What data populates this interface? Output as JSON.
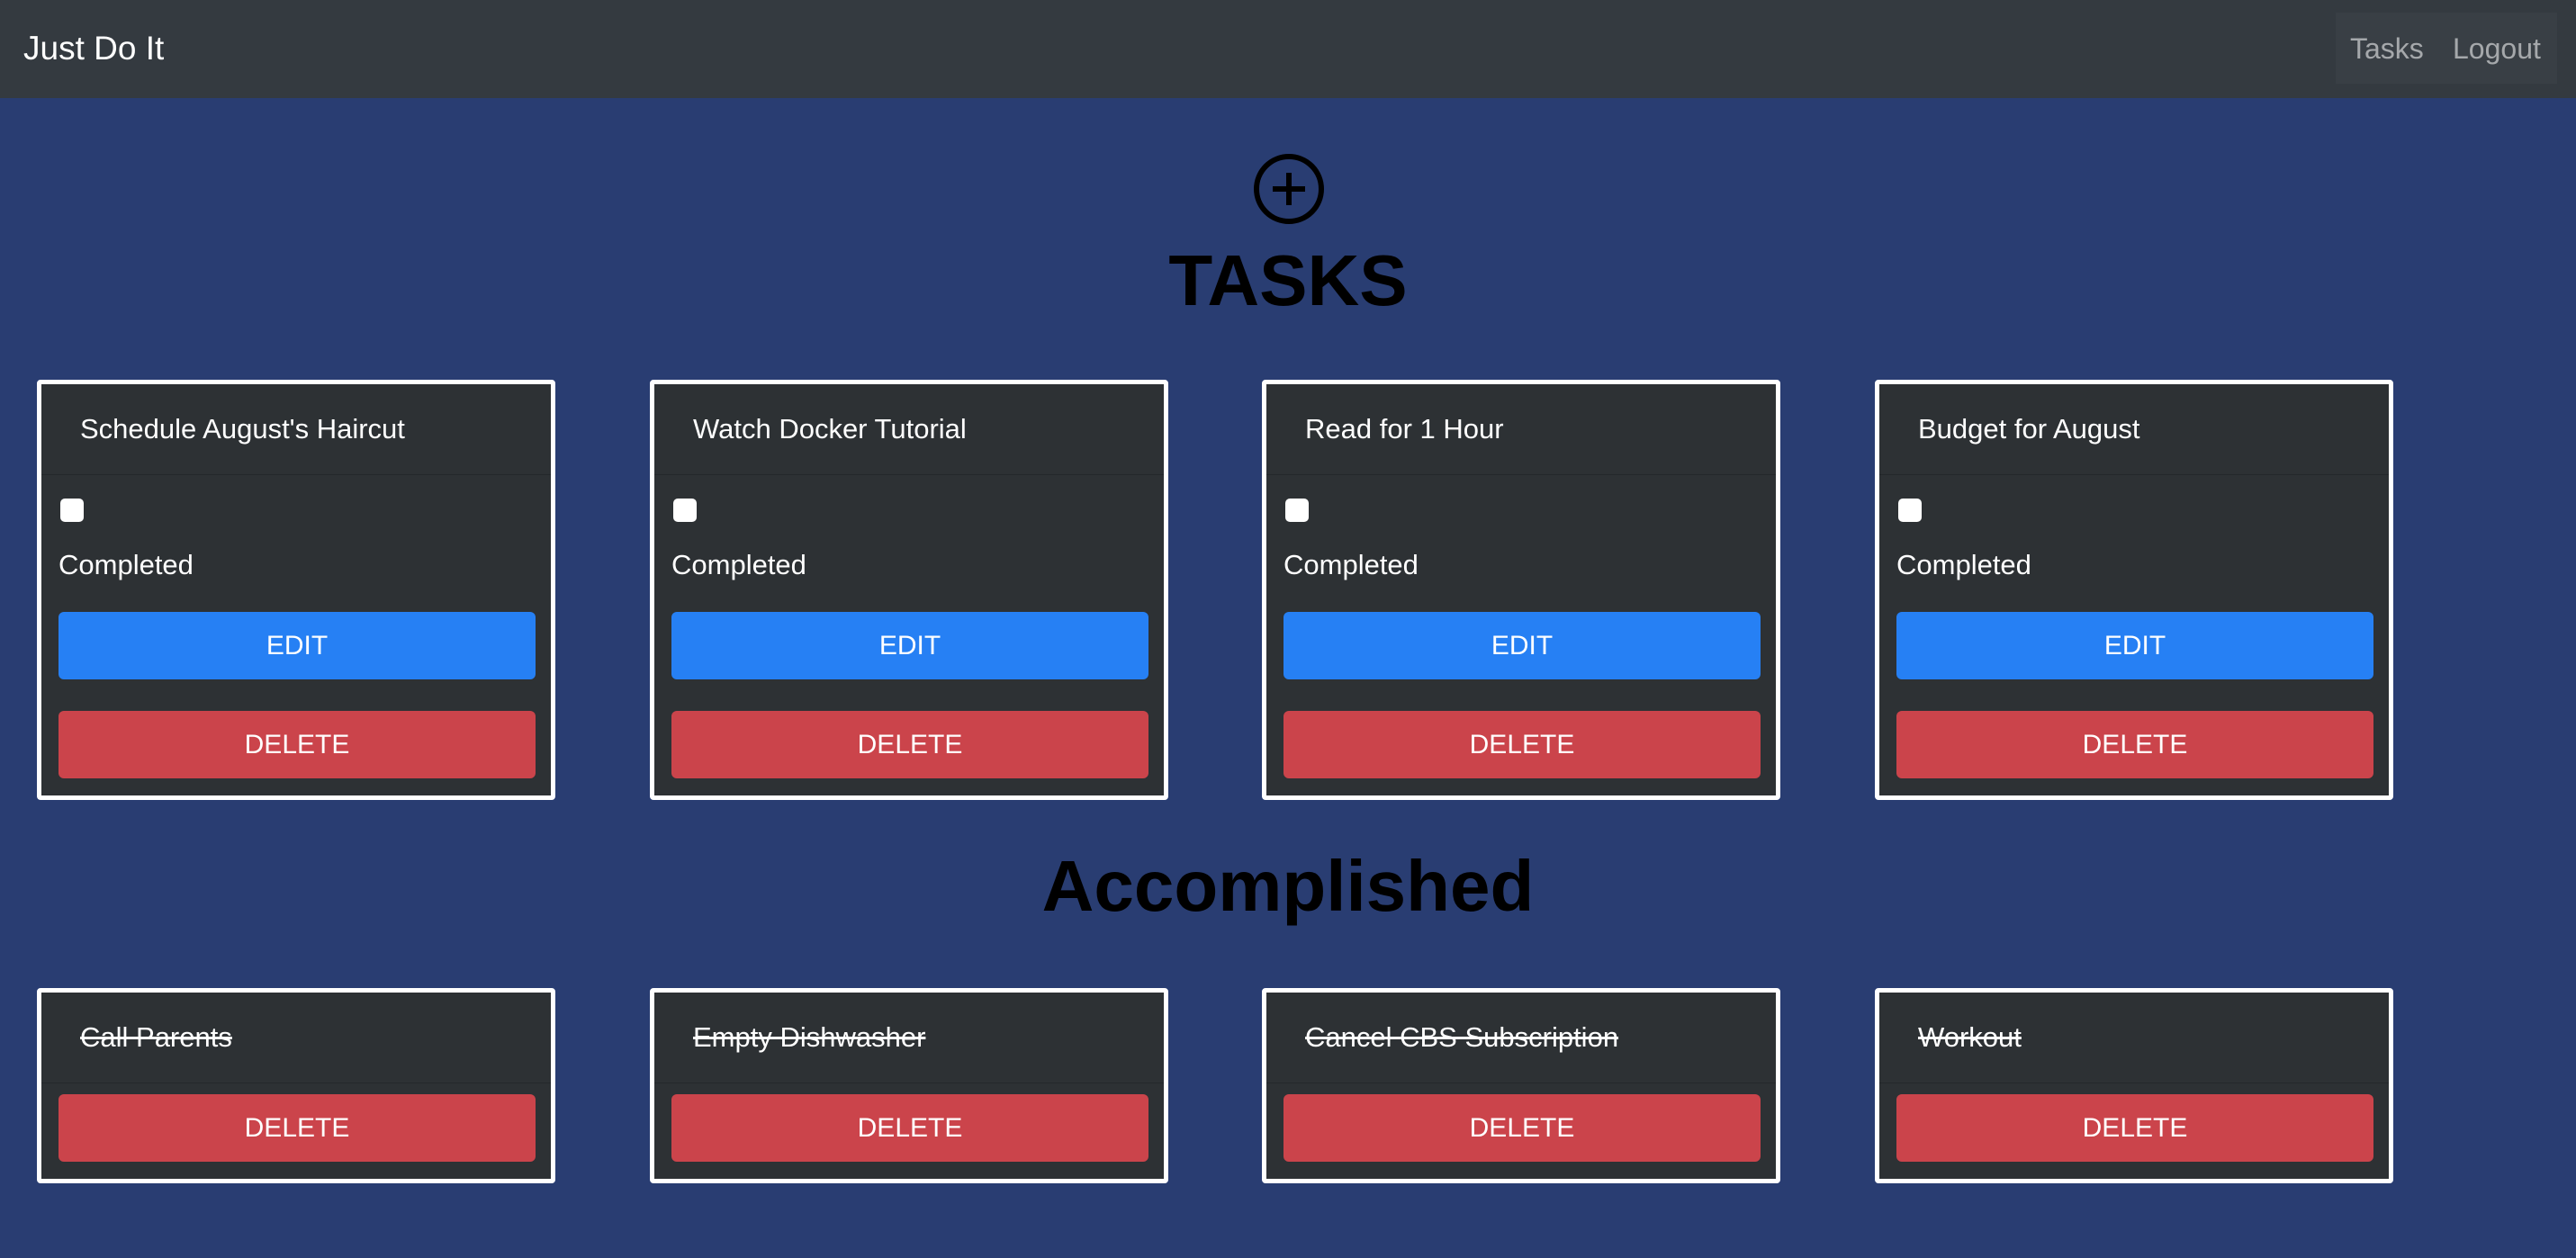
{
  "navbar": {
    "brand": "Just Do It",
    "links": [
      {
        "label": "Tasks"
      },
      {
        "label": "Logout"
      }
    ]
  },
  "header": {
    "add_icon": "plus-circle-icon",
    "tasks_title": "TASKS",
    "accomplished_title": "Accomplished"
  },
  "tasks": [
    {
      "title": "Schedule August's Haircut",
      "completed_label": "Completed",
      "edit_label": "EDIT",
      "delete_label": "DELETE",
      "checked": false
    },
    {
      "title": "Watch Docker Tutorial",
      "completed_label": "Completed",
      "edit_label": "EDIT",
      "delete_label": "DELETE",
      "checked": false
    },
    {
      "title": "Read for 1 Hour",
      "completed_label": "Completed",
      "edit_label": "EDIT",
      "delete_label": "DELETE",
      "checked": false
    },
    {
      "title": "Budget for August",
      "completed_label": "Completed",
      "edit_label": "EDIT",
      "delete_label": "DELETE",
      "checked": false
    }
  ],
  "accomplished": [
    {
      "title": "Call Parents",
      "delete_label": "DELETE"
    },
    {
      "title": "Empty Dishwasher",
      "delete_label": "DELETE"
    },
    {
      "title": "Cancel CBS Subscription",
      "delete_label": "DELETE"
    },
    {
      "title": "Workout",
      "delete_label": "DELETE"
    }
  ],
  "colors": {
    "background": "#293d72",
    "navbar": "#343a40",
    "card": "#2d3134",
    "edit_button": "#2680f4",
    "delete_button": "#cb444b"
  }
}
